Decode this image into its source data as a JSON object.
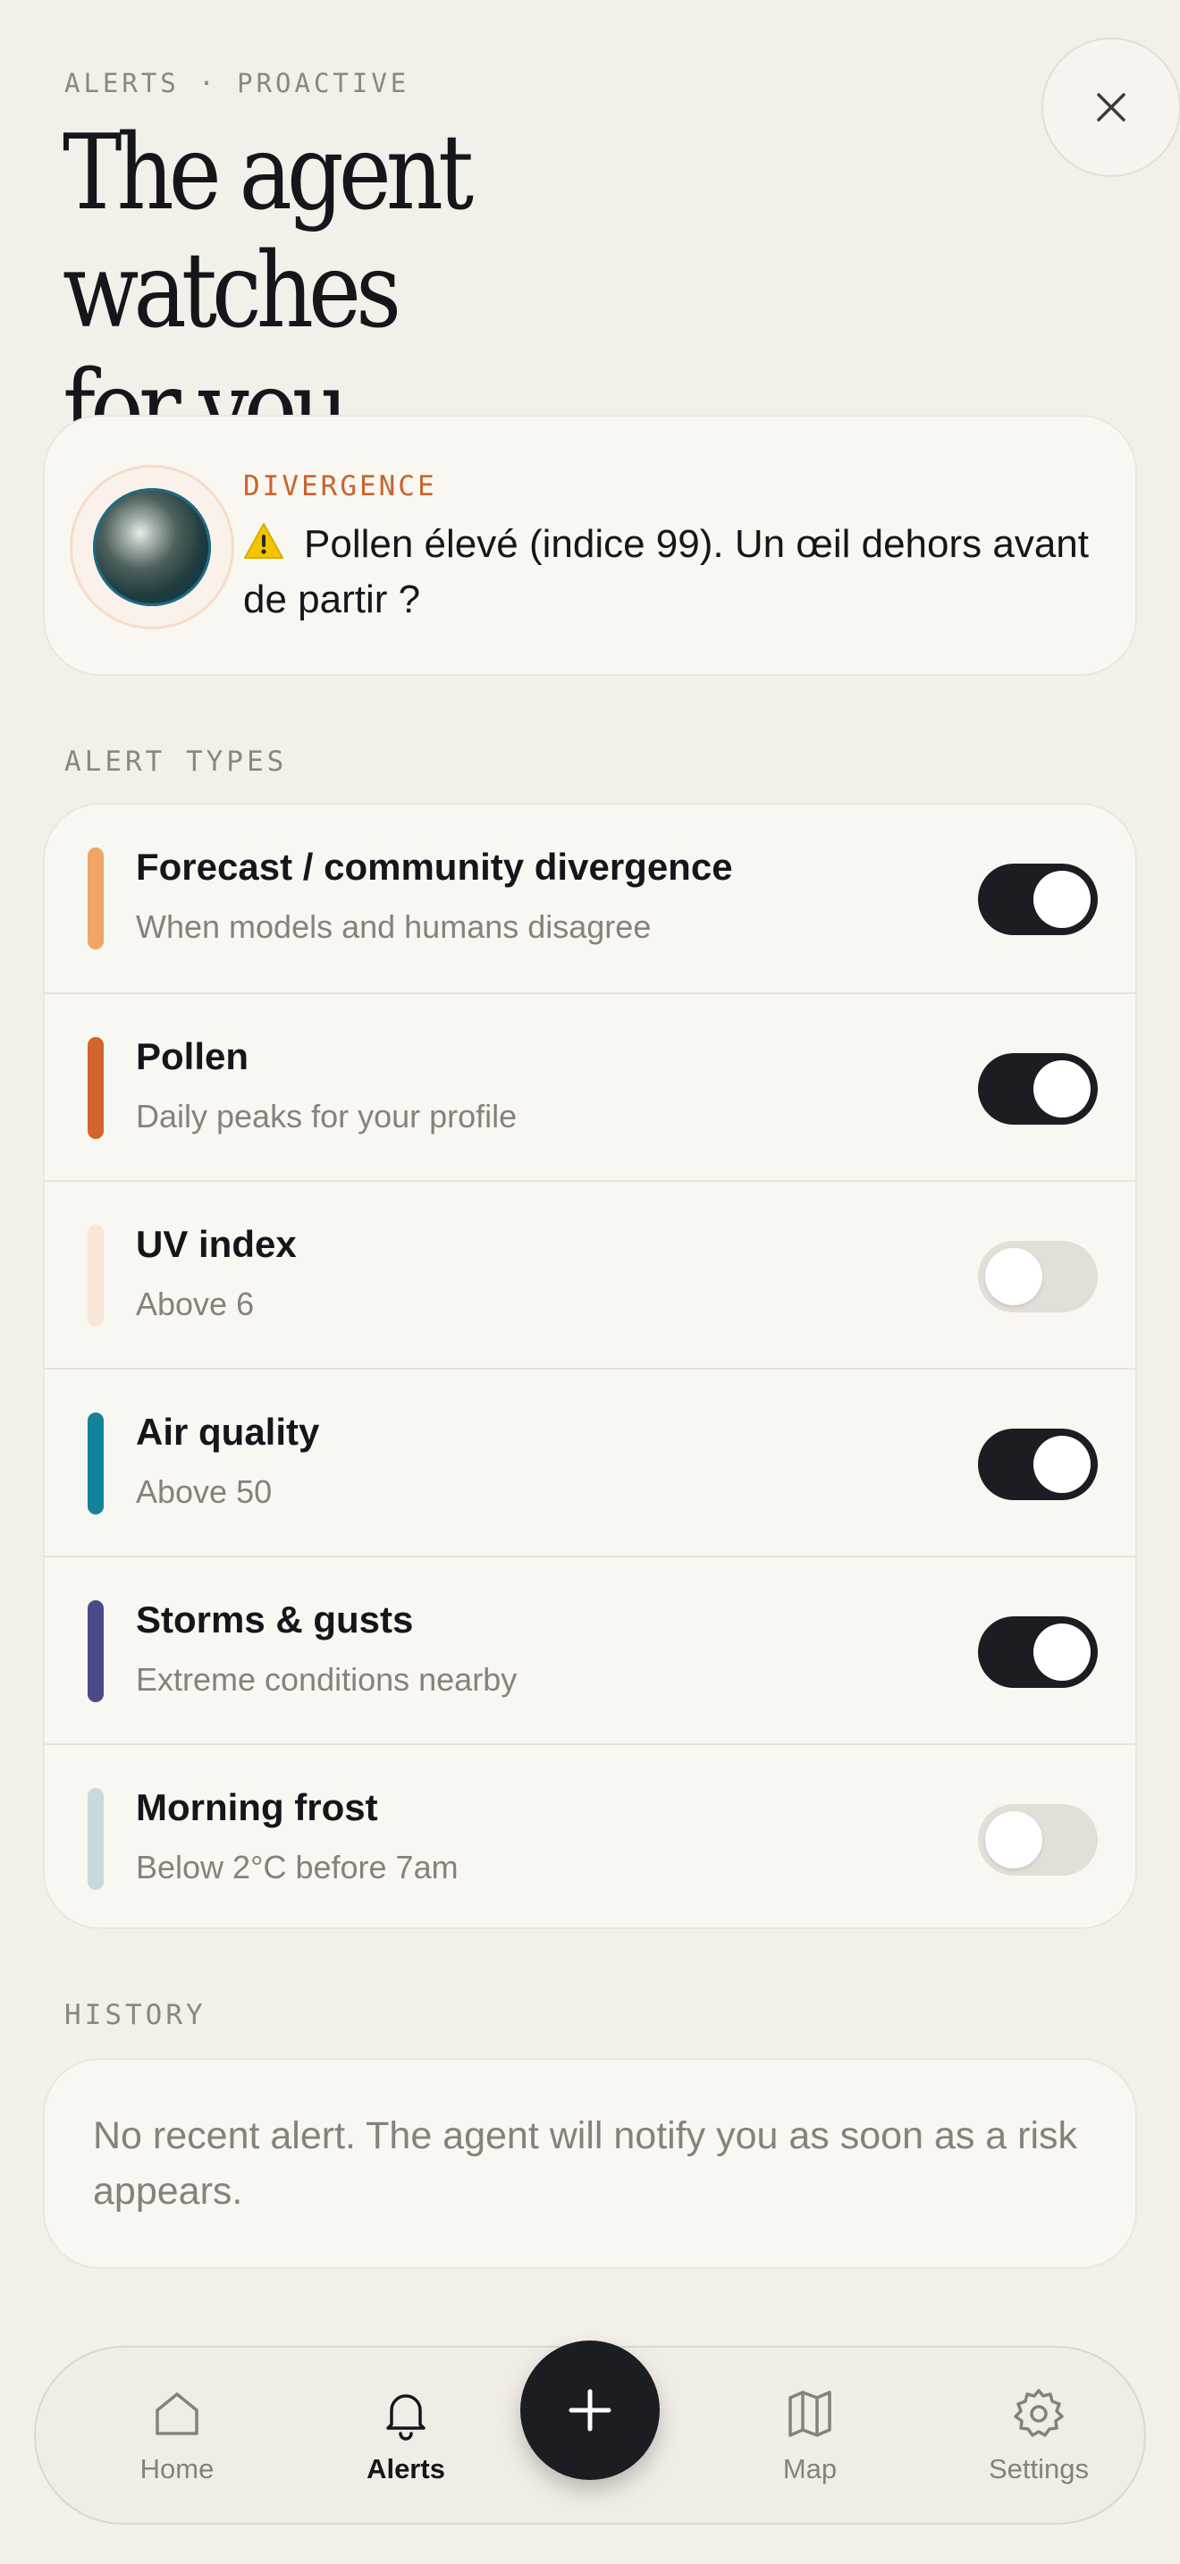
{
  "header": {
    "eyebrow": "ALERTS · PROACTIVE",
    "title_line1": "The agent watches",
    "title_line2": "for you."
  },
  "divergence": {
    "label": "DIVERGENCE",
    "message": "Pollen élevé (indice 99). Un œil dehors avant de partir ?",
    "icon": "warning-icon"
  },
  "alert_types": {
    "label": "ALERT TYPES",
    "items": [
      {
        "title": "Forecast / community divergence",
        "subtitle": "When models and humans disagree",
        "color": "#f0a465",
        "enabled": true
      },
      {
        "title": "Pollen",
        "subtitle": "Daily peaks for your profile",
        "color": "#d2642e",
        "enabled": true
      },
      {
        "title": "UV index",
        "subtitle": "Above 6",
        "color": "#f8e6d6",
        "enabled": false
      },
      {
        "title": "Air quality",
        "subtitle": "Above 50",
        "color": "#13839c",
        "enabled": true
      },
      {
        "title": "Storms & gusts",
        "subtitle": "Extreme conditions nearby",
        "color": "#4a4a88",
        "enabled": true
      },
      {
        "title": "Morning frost",
        "subtitle": "Below 2°C before 7am",
        "color": "#c9d9dd",
        "enabled": false
      }
    ]
  },
  "history": {
    "label": "HISTORY",
    "empty_text": "No recent alert. The agent will notify you as soon as a risk appears."
  },
  "nav": {
    "home": "Home",
    "alerts": "Alerts",
    "map": "Map",
    "settings": "Settings",
    "active": "alerts"
  },
  "colors": {
    "background": "#f3efe9",
    "card": "#f9f7f2",
    "accent_orange": "#c9642c",
    "dark": "#1c1d22"
  }
}
